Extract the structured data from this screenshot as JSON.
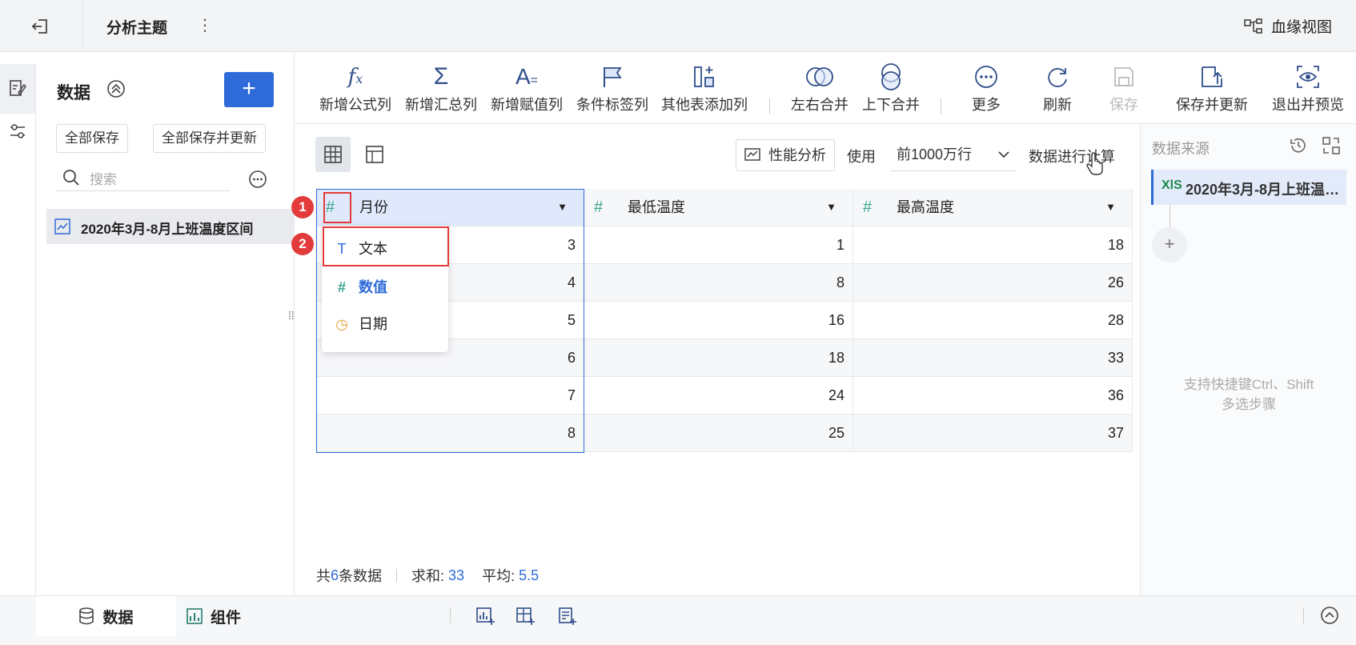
{
  "header": {
    "title": "分析主题",
    "lineage_label": "血缘视图"
  },
  "data_panel": {
    "title": "数据",
    "save_all_label": "全部保存",
    "save_all_update_label": "全部保存并更新",
    "search_placeholder": "搜索",
    "dataset_name": "2020年3月-8月上班温度区间"
  },
  "toolbar": {
    "add_formula": "新增公式列",
    "add_summary": "新增汇总列",
    "add_assign": "新增赋值列",
    "condition_tag": "条件标签列",
    "other_table": "其他表添加列",
    "merge_lr": "左右合并",
    "merge_tb": "上下合并",
    "more": "更多",
    "refresh": "刷新",
    "save": "保存",
    "save_update": "保存并更新",
    "exit_preview": "退出并预览"
  },
  "controls": {
    "perf_label": "性能分析",
    "use_label": "使用",
    "rows_option": "前1000万行",
    "calc_label": "数据进行计算"
  },
  "table": {
    "columns": [
      "月份",
      "最低温度",
      "最高温度"
    ],
    "rows": [
      [
        "3",
        "1",
        "18"
      ],
      [
        "4",
        "8",
        "26"
      ],
      [
        "5",
        "16",
        "28"
      ],
      [
        "6",
        "18",
        "33"
      ],
      [
        "7",
        "24",
        "36"
      ],
      [
        "8",
        "25",
        "37"
      ]
    ]
  },
  "type_menu": {
    "items": [
      {
        "label": "文本",
        "glyph": "T"
      },
      {
        "label": "数值",
        "glyph": "#"
      },
      {
        "label": "日期",
        "glyph": "◷"
      }
    ],
    "badge_1": "1",
    "badge_2": "2"
  },
  "stats": {
    "total_prefix": "共",
    "total_count": "6",
    "total_suffix": "条数据",
    "sum_label": "求和:",
    "sum_value": "33",
    "avg_label": "平均:",
    "avg_value": "5.5"
  },
  "sources": {
    "title": "数据来源",
    "item_badge": "XlS",
    "item_name": "2020年3月-8月上班温度区间",
    "hint_line1": "支持快捷键Ctrl、Shift",
    "hint_line2": "多选步骤"
  },
  "bottom": {
    "data_tab": "数据",
    "component_tab": "组件"
  },
  "colors": {
    "accent": "#2f6bd8",
    "badge": "#e33b3b",
    "hash": "#3aa58f",
    "date": "#e8a23a"
  }
}
